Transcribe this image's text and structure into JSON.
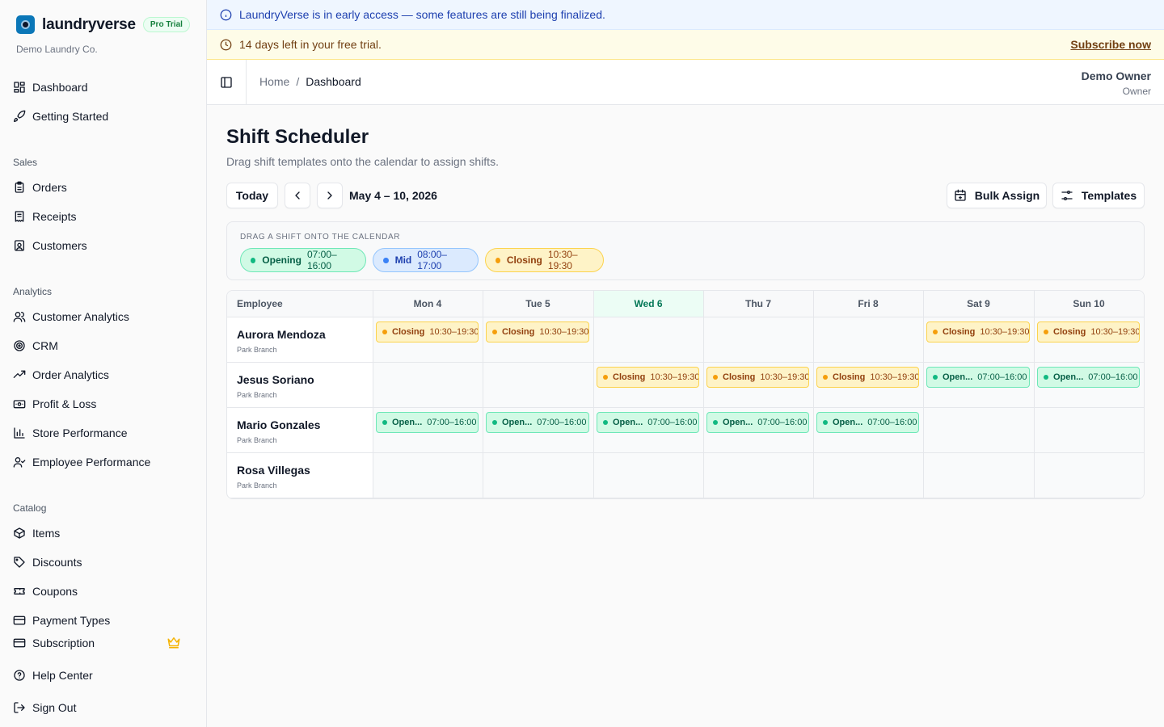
{
  "brand": {
    "name": "laundryverse",
    "badge": "Pro Trial",
    "company": "Demo Laundry Co."
  },
  "nav": {
    "top": [
      "Dashboard",
      "Getting Started"
    ],
    "sections": {
      "sales": {
        "label": "Sales",
        "items": [
          "Orders",
          "Receipts",
          "Customers"
        ]
      },
      "analytics": {
        "label": "Analytics",
        "items": [
          "Customer Analytics",
          "CRM",
          "Order Analytics",
          "Profit & Loss",
          "Store Performance",
          "Employee Performance"
        ]
      },
      "catalog": {
        "label": "Catalog",
        "items": [
          "Items",
          "Discounts",
          "Coupons",
          "Payment Types"
        ]
      }
    },
    "bottom": [
      "Subscription",
      "Help Center",
      "Sign Out"
    ]
  },
  "banners": {
    "info": "LaundryVerse is in early access — some features are still being finalized.",
    "trial": "14 days left in your free trial.",
    "subscribe": "Subscribe now"
  },
  "header": {
    "breadcrumb": {
      "home": "Home",
      "sep": "/",
      "current": "Dashboard"
    },
    "user": {
      "name": "Demo Owner",
      "role": "Owner"
    }
  },
  "page": {
    "title": "Shift Scheduler",
    "subtitle": "Drag shift templates onto the calendar to assign shifts.",
    "today_label": "Today",
    "week_range": "May 4 – 10, 2026",
    "bulk_assign": "Bulk Assign",
    "templates": "Templates"
  },
  "palette": {
    "label": "DRAG A SHIFT ONTO THE CALENDAR",
    "templates": [
      {
        "name": "Opening",
        "time": "07:00–16:00",
        "bg": "#d1fae5",
        "border": "#6ee7b7",
        "color": "#065f46",
        "dot": "#10b981"
      },
      {
        "name": "Mid",
        "time": "08:00–17:00",
        "bg": "#dbeafe",
        "border": "#93c5fd",
        "color": "#1e40af",
        "dot": "#3b82f6"
      },
      {
        "name": "Closing",
        "time": "10:30–19:30",
        "bg": "#fef3c7",
        "border": "#fcd34d",
        "color": "#92400e",
        "dot": "#f59e0b"
      }
    ]
  },
  "grid": {
    "employee_header": "Employee",
    "days": [
      "Mon 4",
      "Tue 5",
      "Wed 6",
      "Thu 7",
      "Fri 8",
      "Sat 9",
      "Sun 10"
    ],
    "today_index": 2,
    "employees": [
      {
        "name": "Aurora Mendoza",
        "branch": "Park Branch",
        "shifts": [
          {
            "type": "closing",
            "name": "Closing",
            "time": "10:30–19:30"
          },
          {
            "type": "closing",
            "name": "Closing",
            "time": "10:30–19:30"
          },
          null,
          null,
          null,
          {
            "type": "closing",
            "name": "Closing",
            "time": "10:30–19:30"
          },
          {
            "type": "closing",
            "name": "Closing",
            "time": "10:30–19:30"
          }
        ]
      },
      {
        "name": "Jesus Soriano",
        "branch": "Park Branch",
        "shifts": [
          null,
          null,
          {
            "type": "closing",
            "name": "Closing",
            "time": "10:30–19:30"
          },
          {
            "type": "closing",
            "name": "Closing",
            "time": "10:30–19:30"
          },
          {
            "type": "closing",
            "name": "Closing",
            "time": "10:30–19:30"
          },
          {
            "type": "opening",
            "name": "Open...",
            "time": "07:00–16:00"
          },
          {
            "type": "opening",
            "name": "Open...",
            "time": "07:00–16:00"
          }
        ]
      },
      {
        "name": "Mario Gonzales",
        "branch": "Park Branch",
        "shifts": [
          {
            "type": "opening",
            "name": "Open...",
            "time": "07:00–16:00"
          },
          {
            "type": "opening",
            "name": "Open...",
            "time": "07:00–16:00"
          },
          {
            "type": "opening",
            "name": "Open...",
            "time": "07:00–16:00"
          },
          {
            "type": "opening",
            "name": "Open...",
            "time": "07:00–16:00"
          },
          {
            "type": "opening",
            "name": "Open...",
            "time": "07:00–16:00"
          },
          null,
          null
        ]
      },
      {
        "name": "Rosa Villegas",
        "branch": "Park Branch",
        "shifts": [
          null,
          null,
          null,
          null,
          null,
          null,
          null
        ]
      }
    ]
  }
}
